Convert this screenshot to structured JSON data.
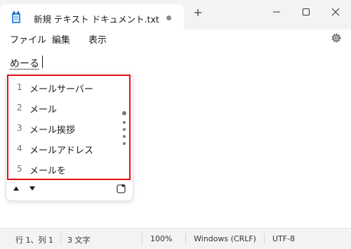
{
  "window": {
    "tab_title": "新規 テキスト ドキュメント.txt",
    "tab_modified_dot": "unsaved-indicator",
    "new_tab_icon": "plus-icon",
    "controls": [
      "minimize-icon",
      "maximize-icon",
      "close-icon"
    ]
  },
  "menu": {
    "items": [
      "ファイル",
      "編集",
      "表示"
    ],
    "settings_icon": "gear-icon"
  },
  "editor": {
    "ime_composition": "めーる"
  },
  "ime_candidates": {
    "items": [
      {
        "index": "1",
        "text": "メールサーバー"
      },
      {
        "index": "2",
        "text": "メール"
      },
      {
        "index": "3",
        "text": "メール挨拶"
      },
      {
        "index": "4",
        "text": "メールアドレス"
      },
      {
        "index": "5",
        "text": "メールを"
      }
    ],
    "highlight_color": "#e81010",
    "controls": [
      "prev-page-icon",
      "next-page-icon",
      "favorite-icon"
    ]
  },
  "status": {
    "position": "行 1、列 1",
    "char_count": "3 文字",
    "zoom": "100%",
    "line_ending": "Windows (CRLF)",
    "encoding": "UTF-8"
  },
  "colors": {
    "titlebar_bg": "#f3f3f3",
    "statusbar_bg": "#f3f3f3",
    "editor_bg": "#ffffff"
  }
}
